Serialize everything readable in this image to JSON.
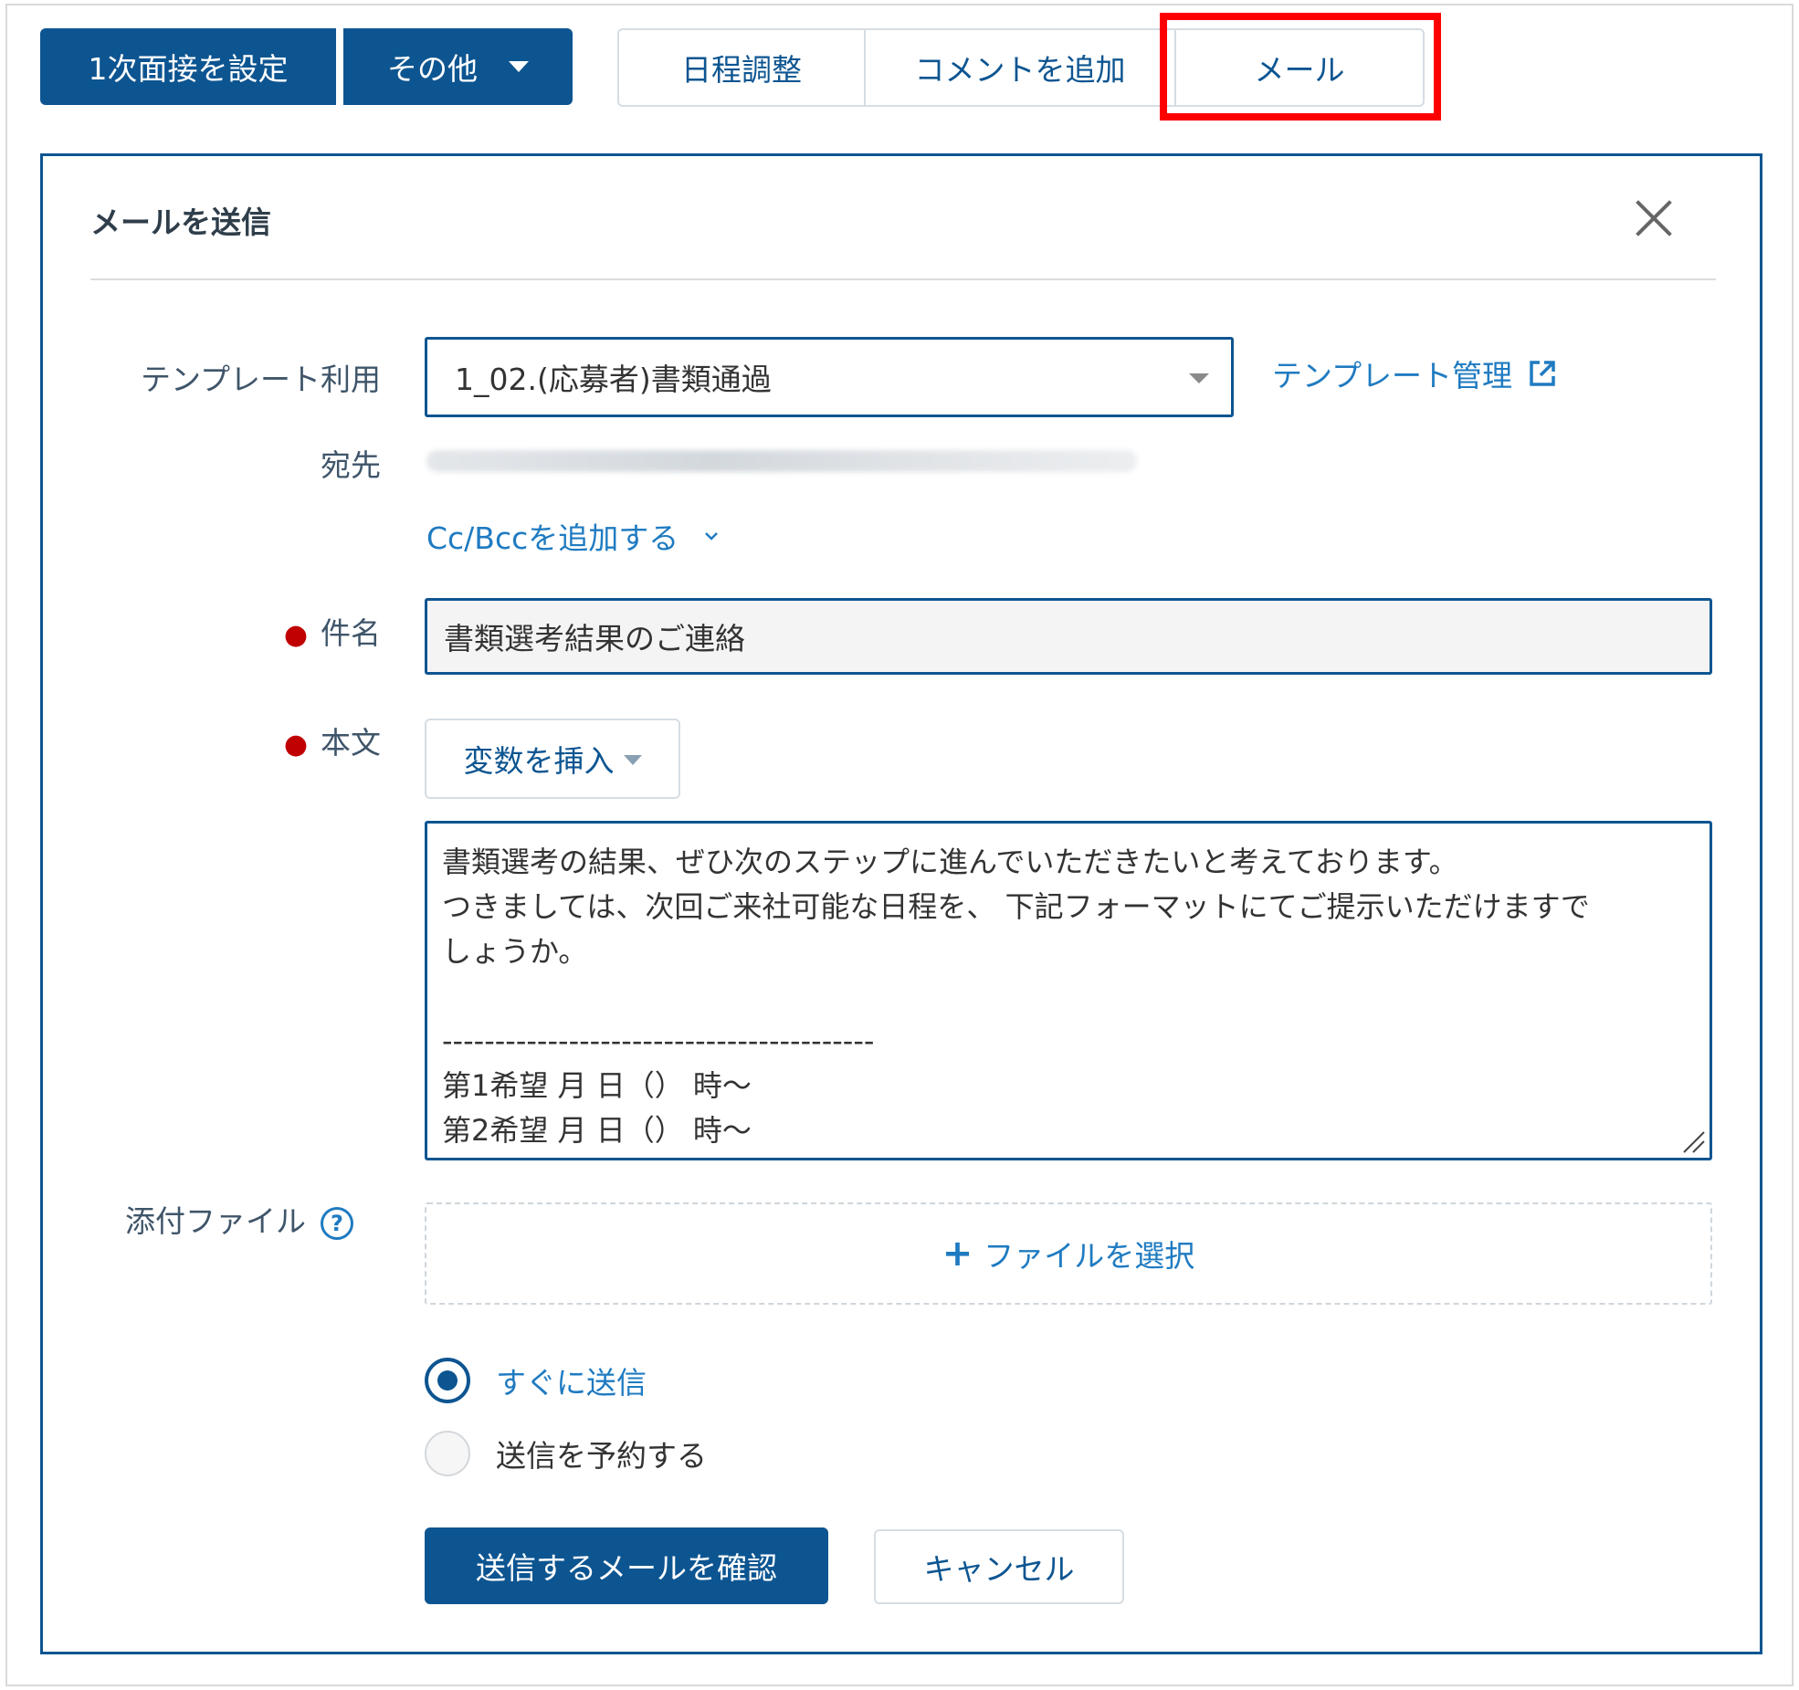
{
  "toolbar": {
    "interview_label": "1次面接を設定",
    "other_label": "その他"
  },
  "tabs": {
    "schedule": "日程調整",
    "comment": "コメントを追加",
    "mail": "メール"
  },
  "dialog": {
    "title": "メールを送信",
    "template_label": "テンプレート利用",
    "template_value": "1_02.(応募者)書類通過",
    "template_manage_link": "テンプレート管理",
    "to_label": "宛先",
    "cc_bcc_link": "Cc/Bccを追加する",
    "subject_label": "件名",
    "subject_value": "書類選考結果のご連絡",
    "body_label": "本文",
    "insert_var_label": "変数を挿入",
    "body_lines": [
      "書類選考の結果、ぜひ次のステップに進んでいただきたいと考えております。",
      "つきましては、次回ご来社可能な日程を、 下記フォーマットにてご提示いただけますで",
      "しょうか。",
      "",
      "-----------------------------------------",
      "第1希望 月 日（） 時〜",
      "第2希望 月 日（） 時〜"
    ],
    "attachment_label": "添付ファイル",
    "attach_select": "ファイルを選択",
    "send_now": "すぐに送信",
    "send_schedule": "送信を予約する",
    "send_mode": "send_now",
    "submit": "送信するメールを確認",
    "cancel": "キャンセル"
  },
  "colors": {
    "primary": "#0d5591",
    "link": "#1f7bc1",
    "highlight": "#ff0000",
    "required": "#c00000"
  }
}
